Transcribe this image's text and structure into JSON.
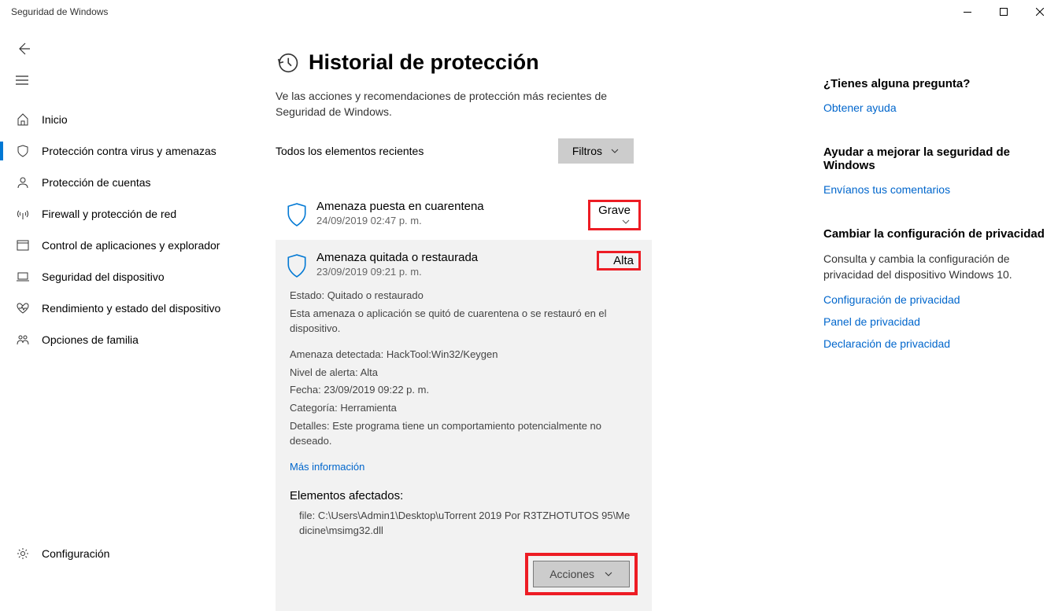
{
  "window": {
    "title": "Seguridad de Windows"
  },
  "sidebar": {
    "items": [
      {
        "label": "Inicio"
      },
      {
        "label": "Protección contra virus y amenazas"
      },
      {
        "label": "Protección de cuentas"
      },
      {
        "label": "Firewall y protección de red"
      },
      {
        "label": "Control de aplicaciones y explorador"
      },
      {
        "label": "Seguridad del dispositivo"
      },
      {
        "label": "Rendimiento y estado del dispositivo"
      },
      {
        "label": "Opciones de familia"
      }
    ],
    "settings": "Configuración"
  },
  "page": {
    "title": "Historial de protección",
    "subtitle": "Ve las acciones y recomendaciones de protección más recientes de Seguridad de Windows.",
    "filter_label": "Todos los elementos recientes",
    "filter_button": "Filtros"
  },
  "threats": [
    {
      "title": "Amenaza puesta en cuarentena",
      "date": "24/09/2019 02:47 p. m.",
      "severity": "Grave"
    },
    {
      "title": "Amenaza quitada o restaurada",
      "date": "23/09/2019 09:21 p. m.",
      "severity": "Alta"
    }
  ],
  "details": {
    "estado": "Estado:  Quitado o restaurado",
    "estado_desc": "Esta amenaza o aplicación se quitó de cuarentena o se restauró en el dispositivo.",
    "detectada": "Amenaza detectada:  HackTool:Win32/Keygen",
    "nivel": "Nivel de alerta:  Alta",
    "fecha": "Fecha:  23/09/2019 09:22 p. m.",
    "categoria": "Categoría:  Herramienta",
    "detalles": "Detalles:  Este programa tiene un comportamiento potencialmente no deseado.",
    "mas_info": "Más información",
    "afectados_h": "Elementos afectados:",
    "afectados_path": "file: C:\\Users\\Admin1\\Desktop\\uTorrent 2019 Por R3TZHOTUTOS 95\\Medicine\\msimg32.dll",
    "acciones": "Acciones"
  },
  "aside": {
    "s1_h": "¿Tienes alguna pregunta?",
    "s1_l1": "Obtener ayuda",
    "s2_h": "Ayudar a mejorar la seguridad de Windows",
    "s2_l1": "Envíanos tus comentarios",
    "s3_h": "Cambiar la configuración de privacidad",
    "s3_txt": "Consulta y cambia la configuración de privacidad del dispositivo Windows 10.",
    "s3_l1": "Configuración de privacidad",
    "s3_l2": "Panel de privacidad",
    "s3_l3": "Declaración de privacidad"
  }
}
